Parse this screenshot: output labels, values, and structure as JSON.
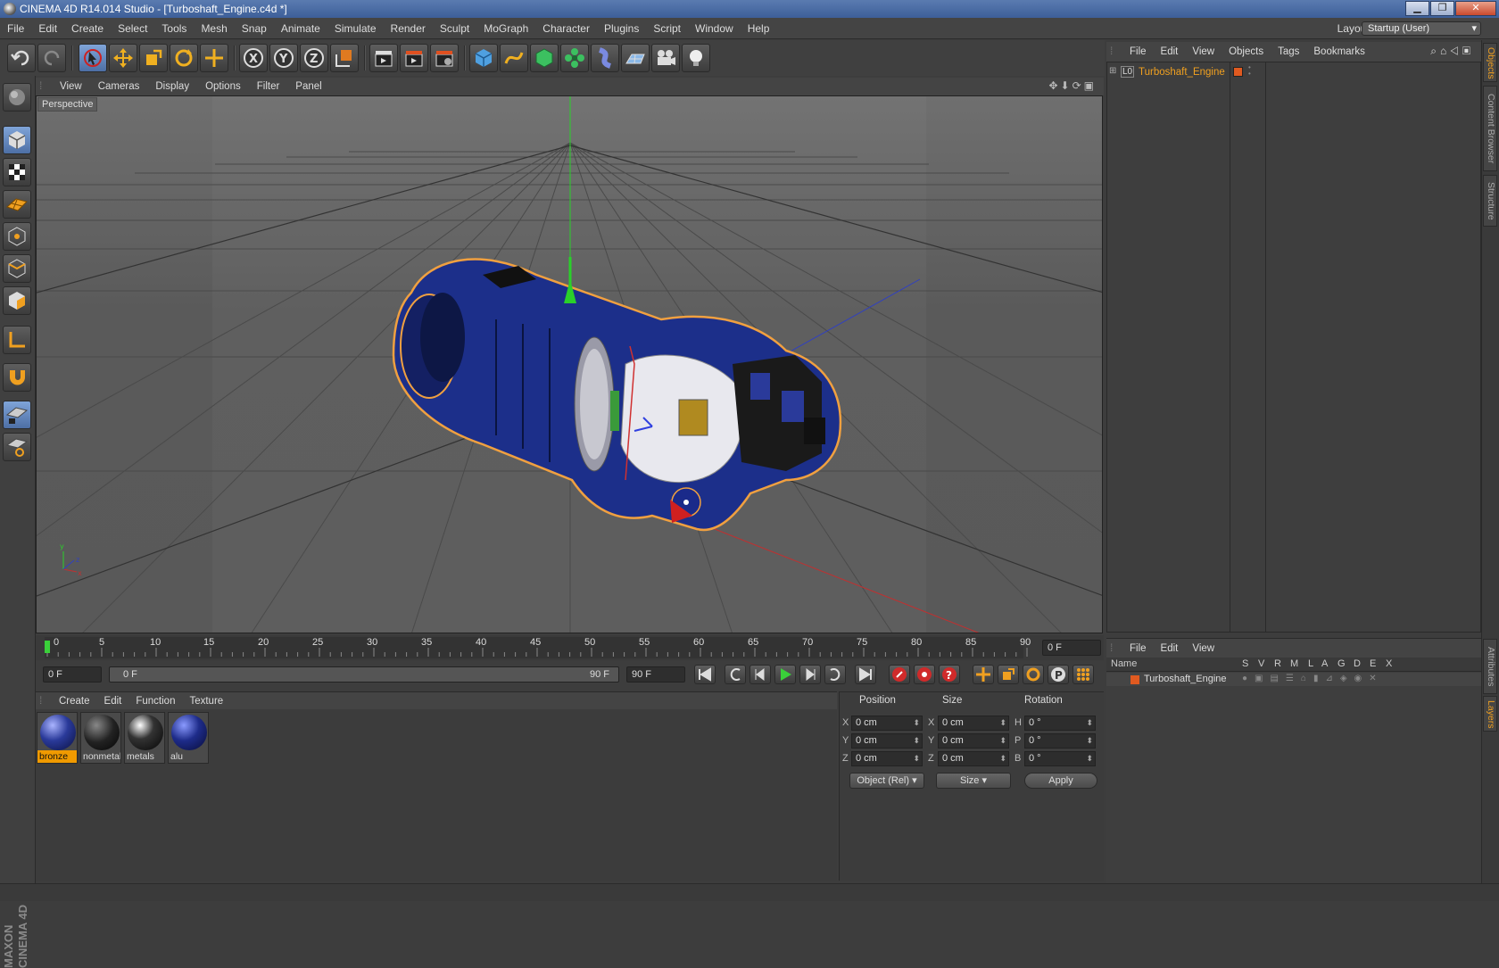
{
  "window": {
    "title": "CINEMA 4D R14.014 Studio - [Turboshaft_Engine.c4d *]",
    "min": "▁",
    "max": "❐",
    "close": "✕"
  },
  "menubar": [
    "File",
    "Edit",
    "Create",
    "Select",
    "Tools",
    "Mesh",
    "Snap",
    "Animate",
    "Simulate",
    "Render",
    "Sculpt",
    "MoGraph",
    "Character",
    "Plugins",
    "Script",
    "Window",
    "Help"
  ],
  "layout": {
    "label": "Layout:",
    "value": "Startup (User)"
  },
  "viewport": {
    "menu": [
      "View",
      "Cameras",
      "Display",
      "Options",
      "Filter",
      "Panel"
    ],
    "label": "Perspective"
  },
  "timeline": {
    "ticks": [
      "0",
      "5",
      "10",
      "15",
      "20",
      "25",
      "30",
      "35",
      "40",
      "45",
      "50",
      "55",
      "60",
      "65",
      "70",
      "75",
      "80",
      "85",
      "90"
    ],
    "current_frame": "0 F"
  },
  "transport": {
    "start": "0 F",
    "range_start": "0 F",
    "range_end": "90 F",
    "end": "90 F"
  },
  "materials": {
    "menu": [
      "Create",
      "Edit",
      "Function",
      "Texture"
    ],
    "items": [
      {
        "name": "bronze",
        "selected": true
      },
      {
        "name": "nonmetal",
        "selected": false
      },
      {
        "name": "metals",
        "selected": false
      },
      {
        "name": "alu",
        "selected": false
      }
    ]
  },
  "coordinates": {
    "headers": {
      "position": "Position",
      "size": "Size",
      "rotation": "Rotation"
    },
    "axes": [
      "X",
      "Y",
      "Z"
    ],
    "rot_axes": [
      "H",
      "P",
      "B"
    ],
    "position": [
      "0 cm",
      "0 cm",
      "0 cm"
    ],
    "size": [
      "0 cm",
      "0 cm",
      "0 cm"
    ],
    "rotation": [
      "0 °",
      "0 °",
      "0 °"
    ],
    "mode": "Object (Rel)",
    "size_mode": "Size",
    "apply": "Apply"
  },
  "object_manager": {
    "menu": [
      "File",
      "Edit",
      "View",
      "Objects",
      "Tags",
      "Bookmarks"
    ],
    "objects": [
      {
        "name": "Turboshaft_Engine",
        "layer": "L0"
      }
    ]
  },
  "layer_manager": {
    "menu": [
      "File",
      "Edit",
      "View"
    ],
    "columns": [
      "Name",
      "S",
      "V",
      "R",
      "M",
      "L",
      "A",
      "G",
      "D",
      "E",
      "X"
    ],
    "rows": [
      {
        "name": "Turboshaft_Engine"
      }
    ]
  },
  "right_tabs": [
    "Objects",
    "Content Browser",
    "Structure",
    "Attributes",
    "Layers"
  ],
  "brand": {
    "line1": "MAXON",
    "line2": "CINEMA 4D"
  },
  "colors": {
    "accent": "#f09a00",
    "selected_blue": "#5b7fbf",
    "engine_blue": "#1c2f8a"
  }
}
